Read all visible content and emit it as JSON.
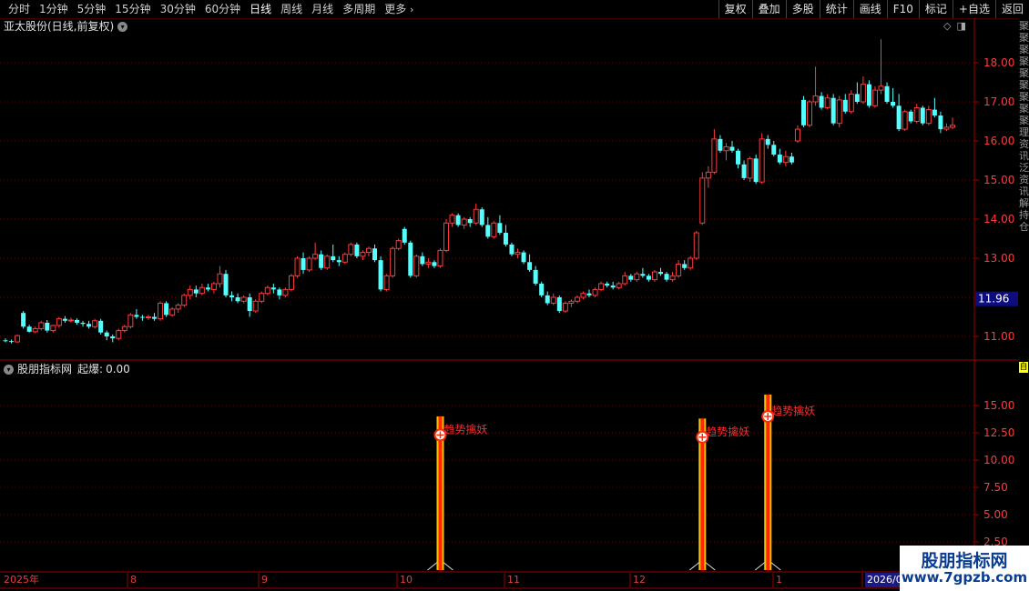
{
  "toolbar": {
    "period_tabs": [
      "分时",
      "1分钟",
      "5分钟",
      "15分钟",
      "30分钟",
      "60分钟",
      "日线",
      "周线",
      "月线",
      "多周期",
      "更多"
    ],
    "active_tab": "日线",
    "buttons": [
      "复权",
      "叠加",
      "多股",
      "统计",
      "画线",
      "F10",
      "标记",
      "+自选",
      "返回"
    ]
  },
  "chart": {
    "title": "亚太股份(日线,前复权)",
    "current_price_label": "11.96",
    "price_ticks": [
      "18.00",
      "17.00",
      "16.00",
      "15.00",
      "14.00",
      "13.00",
      "11.00"
    ],
    "colors": {
      "up": "#ff3b3b",
      "down": "#54ffff",
      "grid": "#6a0000",
      "axis": "#9b0000"
    }
  },
  "indicator": {
    "name": "股朋指标网",
    "metric_label": "起爆:",
    "metric_value": "0.00",
    "signal_label": "趋势擒妖",
    "ticks": [
      "15.00",
      "12.50",
      "10.00",
      "7.50",
      "5.00",
      "2.50"
    ]
  },
  "time_axis": {
    "labels": [
      "2025年",
      "8",
      "9",
      "10",
      "11",
      "12",
      "1",
      "2026/0"
    ],
    "highlight": "2026/0"
  },
  "side_strip": {
    "text": "聚聚聚聚聚聚聚聚聚理资讯泛资讯解持仓",
    "box": "自"
  },
  "watermark": {
    "title": "股朋指标网",
    "url": "www.7gpzb.com"
  },
  "chart_data": {
    "type": "candlestick",
    "x_labels": [
      "2025年",
      "8",
      "9",
      "10",
      "11",
      "12",
      "1",
      "2026/0"
    ],
    "ylim": [
      10.6,
      18.8
    ],
    "ohlc": [
      [
        10.9,
        10.95,
        10.85,
        10.88
      ],
      [
        10.88,
        10.92,
        10.82,
        10.86
      ],
      [
        10.86,
        11.05,
        10.84,
        11.02
      ],
      [
        11.6,
        11.65,
        11.2,
        11.25
      ],
      [
        11.25,
        11.3,
        11.1,
        11.12
      ],
      [
        11.12,
        11.25,
        11.08,
        11.2
      ],
      [
        11.2,
        11.4,
        11.15,
        11.35
      ],
      [
        11.35,
        11.42,
        11.1,
        11.15
      ],
      [
        11.15,
        11.3,
        11.1,
        11.28
      ],
      [
        11.28,
        11.5,
        11.22,
        11.45
      ],
      [
        11.45,
        11.52,
        11.35,
        11.4
      ],
      [
        11.4,
        11.48,
        11.35,
        11.42
      ],
      [
        11.42,
        11.46,
        11.3,
        11.35
      ],
      [
        11.35,
        11.4,
        11.25,
        11.32
      ],
      [
        11.32,
        11.4,
        11.2,
        11.25
      ],
      [
        11.25,
        11.45,
        11.2,
        11.4
      ],
      [
        11.4,
        11.45,
        11.05,
        11.1
      ],
      [
        11.1,
        11.15,
        10.9,
        11.0
      ],
      [
        11.0,
        11.05,
        10.85,
        10.95
      ],
      [
        10.95,
        11.2,
        10.9,
        11.15
      ],
      [
        11.15,
        11.3,
        11.1,
        11.25
      ],
      [
        11.25,
        11.6,
        11.2,
        11.55
      ],
      [
        11.55,
        11.7,
        11.45,
        11.5
      ],
      [
        11.5,
        11.55,
        11.4,
        11.48
      ],
      [
        11.48,
        11.55,
        11.42,
        11.5
      ],
      [
        11.5,
        11.6,
        11.4,
        11.45
      ],
      [
        11.45,
        11.9,
        11.4,
        11.85
      ],
      [
        11.85,
        11.9,
        11.5,
        11.55
      ],
      [
        11.55,
        11.75,
        11.5,
        11.7
      ],
      [
        11.7,
        11.85,
        11.6,
        11.8
      ],
      [
        11.8,
        12.1,
        11.75,
        12.05
      ],
      [
        12.05,
        12.3,
        11.95,
        12.2
      ],
      [
        12.2,
        12.3,
        12.0,
        12.1
      ],
      [
        12.1,
        12.35,
        12.05,
        12.25
      ],
      [
        12.25,
        12.35,
        12.15,
        12.2
      ],
      [
        12.2,
        12.4,
        12.1,
        12.35
      ],
      [
        12.35,
        12.8,
        12.25,
        12.6
      ],
      [
        12.6,
        12.7,
        12.0,
        12.05
      ],
      [
        12.05,
        12.15,
        11.9,
        12.0
      ],
      [
        12.0,
        12.1,
        11.85,
        11.9
      ],
      [
        11.9,
        12.05,
        11.85,
        12.0
      ],
      [
        12.0,
        12.1,
        11.5,
        11.65
      ],
      [
        11.65,
        11.95,
        11.6,
        11.9
      ],
      [
        11.9,
        12.15,
        11.85,
        12.1
      ],
      [
        12.1,
        12.3,
        12.05,
        12.25
      ],
      [
        12.25,
        12.35,
        12.1,
        12.2
      ],
      [
        12.2,
        12.25,
        11.95,
        12.05
      ],
      [
        12.05,
        12.25,
        12.0,
        12.2
      ],
      [
        12.2,
        12.6,
        12.15,
        12.55
      ],
      [
        12.55,
        13.05,
        12.5,
        13.0
      ],
      [
        13.0,
        13.15,
        12.6,
        12.7
      ],
      [
        12.7,
        13.05,
        12.65,
        13.0
      ],
      [
        13.0,
        13.4,
        12.95,
        13.1
      ],
      [
        13.1,
        13.2,
        12.7,
        12.75
      ],
      [
        12.75,
        13.1,
        12.7,
        13.05
      ],
      [
        13.05,
        13.35,
        12.9,
        12.95
      ],
      [
        12.95,
        13.05,
        12.8,
        12.9
      ],
      [
        12.9,
        13.15,
        12.85,
        13.1
      ],
      [
        13.1,
        13.4,
        13.05,
        13.35
      ],
      [
        13.35,
        13.4,
        13.0,
        13.05
      ],
      [
        13.05,
        13.2,
        12.95,
        13.15
      ],
      [
        13.15,
        13.3,
        13.05,
        13.25
      ],
      [
        13.25,
        13.35,
        12.9,
        12.95
      ],
      [
        12.95,
        13.05,
        12.15,
        12.2
      ],
      [
        12.2,
        12.6,
        12.15,
        12.55
      ],
      [
        12.55,
        13.3,
        12.5,
        13.25
      ],
      [
        13.25,
        13.5,
        13.2,
        13.45
      ],
      [
        13.75,
        13.8,
        13.35,
        13.4
      ],
      [
        13.4,
        13.45,
        12.5,
        12.55
      ],
      [
        12.55,
        13.1,
        12.5,
        13.05
      ],
      [
        13.05,
        13.15,
        12.8,
        12.85
      ],
      [
        12.85,
        13.0,
        12.75,
        12.9
      ],
      [
        12.9,
        12.95,
        12.75,
        12.8
      ],
      [
        12.8,
        13.25,
        12.75,
        13.2
      ],
      [
        13.2,
        14.0,
        13.15,
        13.9
      ],
      [
        13.9,
        14.15,
        13.8,
        14.1
      ],
      [
        14.1,
        14.15,
        13.8,
        13.85
      ],
      [
        13.85,
        14.05,
        13.75,
        14.0
      ],
      [
        14.0,
        14.05,
        13.8,
        13.9
      ],
      [
        13.9,
        14.4,
        13.85,
        14.25
      ],
      [
        14.25,
        14.3,
        13.8,
        13.85
      ],
      [
        13.85,
        14.05,
        13.5,
        13.55
      ],
      [
        13.55,
        13.95,
        13.5,
        13.9
      ],
      [
        13.9,
        14.1,
        13.6,
        13.65
      ],
      [
        13.65,
        13.85,
        13.3,
        13.35
      ],
      [
        13.35,
        13.4,
        13.05,
        13.1
      ],
      [
        13.1,
        13.25,
        13.0,
        13.15
      ],
      [
        13.15,
        13.2,
        12.85,
        12.9
      ],
      [
        12.9,
        13.1,
        12.65,
        12.7
      ],
      [
        12.7,
        12.8,
        12.3,
        12.35
      ],
      [
        12.35,
        12.4,
        12.0,
        12.05
      ],
      [
        12.05,
        12.15,
        11.8,
        11.85
      ],
      [
        11.85,
        12.1,
        11.8,
        12.0
      ],
      [
        12.0,
        12.05,
        11.6,
        11.65
      ],
      [
        11.65,
        11.9,
        11.6,
        11.85
      ],
      [
        11.85,
        11.95,
        11.75,
        11.9
      ],
      [
        11.9,
        12.05,
        11.85,
        12.0
      ],
      [
        12.0,
        12.15,
        11.95,
        12.1
      ],
      [
        12.1,
        12.2,
        12.0,
        12.05
      ],
      [
        12.05,
        12.25,
        12.0,
        12.2
      ],
      [
        12.2,
        12.4,
        12.15,
        12.35
      ],
      [
        12.35,
        12.4,
        12.25,
        12.3
      ],
      [
        12.3,
        12.4,
        12.2,
        12.25
      ],
      [
        12.25,
        12.4,
        12.2,
        12.35
      ],
      [
        12.35,
        12.65,
        12.3,
        12.55
      ],
      [
        12.55,
        12.6,
        12.4,
        12.45
      ],
      [
        12.45,
        12.65,
        12.4,
        12.6
      ],
      [
        12.6,
        12.75,
        12.5,
        12.55
      ],
      [
        12.55,
        12.6,
        12.4,
        12.45
      ],
      [
        12.45,
        12.7,
        12.4,
        12.65
      ],
      [
        12.65,
        12.75,
        12.55,
        12.6
      ],
      [
        12.6,
        12.65,
        12.4,
        12.45
      ],
      [
        12.45,
        12.65,
        12.4,
        12.55
      ],
      [
        12.55,
        12.95,
        12.5,
        12.85
      ],
      [
        12.85,
        12.95,
        12.7,
        12.75
      ],
      [
        12.75,
        13.05,
        12.7,
        13.0
      ],
      [
        13.0,
        13.7,
        12.95,
        13.65
      ],
      [
        13.9,
        15.2,
        13.85,
        15.05
      ],
      [
        15.05,
        15.35,
        14.8,
        15.2
      ],
      [
        15.2,
        16.3,
        15.15,
        16.05
      ],
      [
        16.05,
        16.15,
        15.7,
        15.75
      ],
      [
        15.75,
        15.95,
        15.5,
        15.85
      ],
      [
        15.85,
        16.0,
        15.7,
        15.75
      ],
      [
        15.75,
        15.8,
        15.3,
        15.4
      ],
      [
        15.4,
        15.5,
        15.0,
        15.05
      ],
      [
        15.05,
        15.6,
        14.95,
        15.55
      ],
      [
        15.55,
        15.65,
        14.9,
        14.95
      ],
      [
        14.95,
        16.2,
        14.9,
        16.05
      ],
      [
        16.05,
        16.15,
        15.8,
        15.9
      ],
      [
        15.9,
        16.0,
        15.6,
        15.65
      ],
      [
        15.65,
        15.8,
        15.4,
        15.45
      ],
      [
        15.45,
        15.75,
        15.35,
        15.6
      ],
      [
        15.6,
        15.7,
        15.4,
        15.45
      ],
      [
        16.0,
        16.4,
        15.95,
        16.3
      ],
      [
        17.05,
        17.15,
        16.35,
        16.4
      ],
      [
        16.4,
        17.05,
        16.35,
        17.0
      ],
      [
        17.0,
        17.9,
        16.9,
        17.15
      ],
      [
        17.15,
        17.25,
        16.8,
        16.85
      ],
      [
        16.85,
        17.2,
        16.8,
        17.1
      ],
      [
        17.1,
        17.2,
        16.4,
        16.45
      ],
      [
        16.45,
        17.15,
        16.35,
        17.05
      ],
      [
        17.05,
        17.2,
        16.7,
        16.75
      ],
      [
        16.75,
        17.3,
        16.7,
        17.2
      ],
      [
        17.2,
        17.5,
        16.95,
        17.0
      ],
      [
        17.0,
        17.65,
        16.95,
        17.45
      ],
      [
        17.45,
        17.55,
        16.85,
        16.9
      ],
      [
        16.9,
        17.4,
        16.85,
        17.3
      ],
      [
        17.3,
        18.6,
        17.2,
        17.4
      ],
      [
        17.4,
        17.5,
        16.95,
        17.0
      ],
      [
        17.0,
        17.35,
        16.85,
        16.9
      ],
      [
        16.9,
        17.2,
        16.25,
        16.3
      ],
      [
        16.3,
        16.8,
        16.25,
        16.75
      ],
      [
        16.75,
        16.8,
        16.45,
        16.5
      ],
      [
        16.5,
        16.95,
        16.45,
        16.85
      ],
      [
        16.85,
        16.9,
        16.4,
        16.45
      ],
      [
        16.45,
        16.9,
        16.4,
        16.8
      ],
      [
        16.8,
        17.1,
        16.6,
        16.65
      ],
      [
        16.65,
        16.75,
        16.2,
        16.3
      ],
      [
        16.3,
        16.45,
        16.25,
        16.35
      ],
      [
        16.35,
        16.6,
        16.3,
        16.4
      ]
    ],
    "signals": [
      {
        "candle": 73,
        "bar_top": 14.0,
        "marker": 12.3
      },
      {
        "candle": 117,
        "bar_top": 13.8,
        "marker": 12.1
      },
      {
        "candle": 128,
        "bar_top": 16.0,
        "marker": 14.0
      }
    ]
  }
}
